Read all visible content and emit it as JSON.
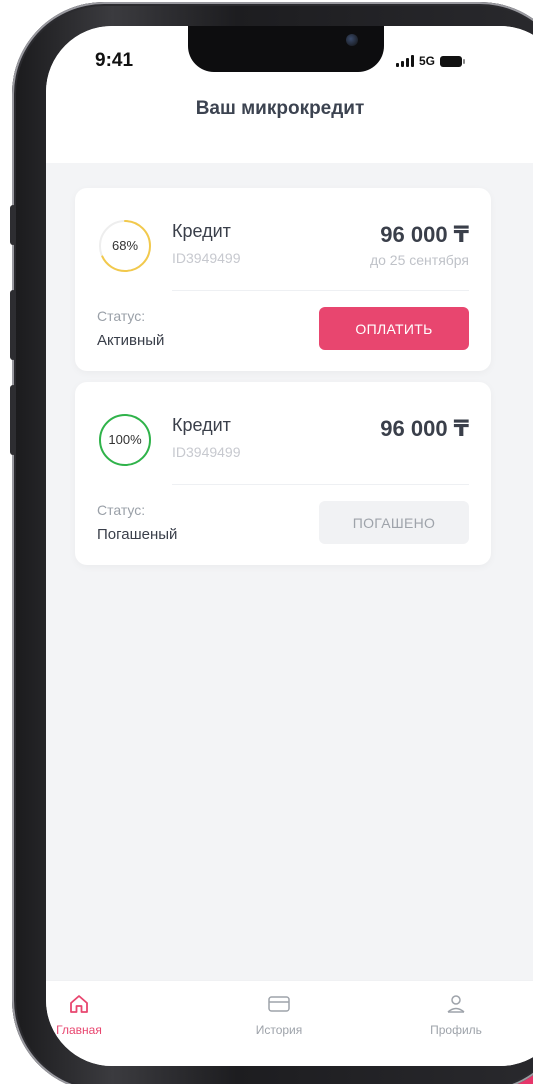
{
  "status_bar": {
    "time": "9:41",
    "network": "5G"
  },
  "header": {
    "title": "Ваш микрокредит"
  },
  "loans": [
    {
      "progress_label": "68%",
      "progress": 0.68,
      "ring_color": "#f2c94c",
      "title": "Кредит",
      "id": "ID3949499",
      "amount": "96 000 ₸",
      "due": "до 25 сентября",
      "status_label": "Статус:",
      "status_value": "Активный",
      "action_label": "ОПЛАТИТЬ"
    },
    {
      "progress_label": "100%",
      "progress": 1.0,
      "ring_color": "#2fb34a",
      "title": "Кредит",
      "id": "ID3949499",
      "amount": "96 000 ₸",
      "status_label": "Статус:",
      "status_value": "Погашеный",
      "action_label": "ПОГАШЕНО"
    }
  ],
  "tabbar": {
    "items": [
      {
        "label": "Главная",
        "icon": "home-icon",
        "active": true
      },
      {
        "label": "История",
        "icon": "card-icon",
        "active": false
      },
      {
        "label": "Профиль",
        "icon": "user-icon",
        "active": false
      }
    ]
  },
  "colors": {
    "accent": "#e8466f",
    "inactive": "#9ea3aa"
  }
}
